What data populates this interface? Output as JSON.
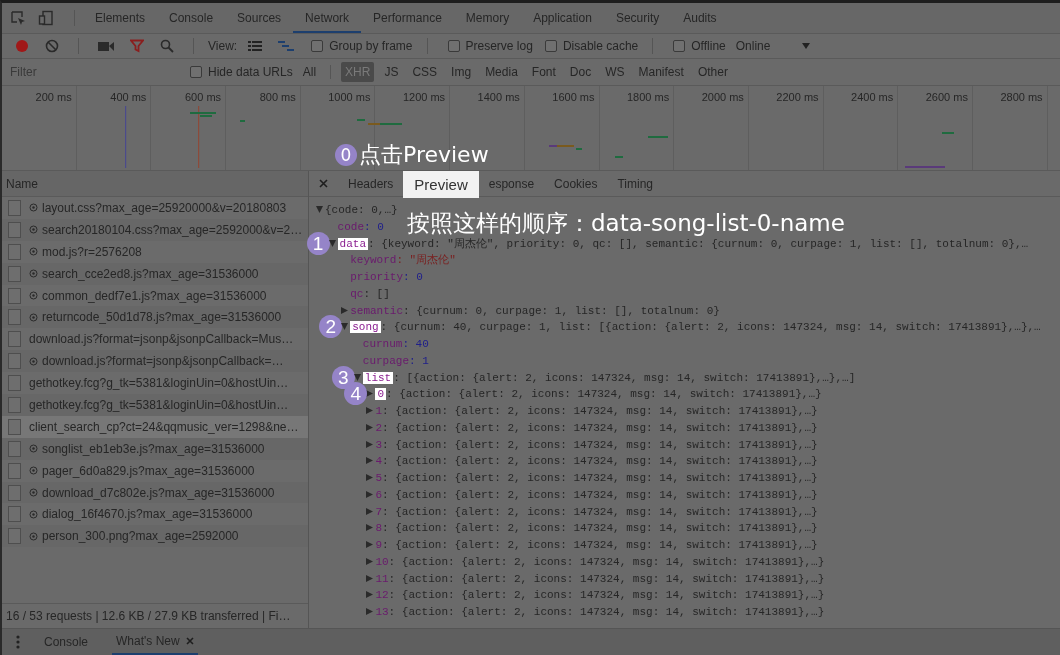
{
  "devtools_tabs": [
    {
      "label": "Elements",
      "selected": false
    },
    {
      "label": "Console",
      "selected": false
    },
    {
      "label": "Sources",
      "selected": false
    },
    {
      "label": "Network",
      "selected": true
    },
    {
      "label": "Performance",
      "selected": false
    },
    {
      "label": "Memory",
      "selected": false
    },
    {
      "label": "Application",
      "selected": false
    },
    {
      "label": "Security",
      "selected": false
    },
    {
      "label": "Audits",
      "selected": false
    }
  ],
  "toolbar": {
    "recording": true,
    "view_label": "View:",
    "options": [
      {
        "label": "Group by frame",
        "checked": false
      },
      {
        "label": "Preserve log",
        "checked": false
      },
      {
        "label": "Disable cache",
        "checked": false
      },
      {
        "label": "Offline",
        "checked": false
      }
    ],
    "throttling": "Online"
  },
  "filter": {
    "placeholder": "Filter",
    "hide_data_urls": {
      "label": "Hide data URLs",
      "checked": false
    },
    "types": [
      {
        "label": "All",
        "selected": false
      },
      {
        "label": "XHR",
        "selected": true
      },
      {
        "label": "JS",
        "selected": false
      },
      {
        "label": "CSS",
        "selected": false
      },
      {
        "label": "Img",
        "selected": false
      },
      {
        "label": "Media",
        "selected": false
      },
      {
        "label": "Font",
        "selected": false
      },
      {
        "label": "Doc",
        "selected": false
      },
      {
        "label": "WS",
        "selected": false
      },
      {
        "label": "Manifest",
        "selected": false
      },
      {
        "label": "Other",
        "selected": false
      }
    ]
  },
  "timeline": {
    "ticks": [
      "200 ms",
      "400 ms",
      "600 ms",
      "800 ms",
      "1000 ms",
      "1200 ms",
      "1400 ms",
      "1600 ms",
      "1800 ms",
      "2000 ms",
      "2200 ms",
      "2400 ms",
      "2600 ms",
      "2800 ms"
    ]
  },
  "annotation_step": {
    "badge": "0",
    "text": "点击Preview"
  },
  "instruction": "按照这样的顺序：data-song-list-0-name",
  "requests": {
    "header": "Name",
    "rows": [
      {
        "name": "layout.css?max_age=25920000&v=20180803",
        "cached": true,
        "selected": false
      },
      {
        "name": "search20180104.css?max_age=2592000&v=2…",
        "cached": true,
        "selected": false
      },
      {
        "name": "mod.js?r=2576208",
        "cached": true,
        "selected": false
      },
      {
        "name": "search_cce2ed8.js?max_age=31536000",
        "cached": true,
        "selected": false
      },
      {
        "name": "common_dedf7e1.js?max_age=31536000",
        "cached": true,
        "selected": false
      },
      {
        "name": "returncode_50d1d78.js?max_age=31536000",
        "cached": true,
        "selected": false
      },
      {
        "name": "download.js?format=jsonp&jsonpCallback=Mus…",
        "cached": false,
        "selected": false
      },
      {
        "name": "download.js?format=jsonp&jsonpCallback=…",
        "cached": true,
        "selected": false
      },
      {
        "name": "gethotkey.fcg?g_tk=5381&loginUin=0&hostUin…",
        "cached": false,
        "selected": false
      },
      {
        "name": "gethotkey.fcg?g_tk=5381&loginUin=0&hostUin…",
        "cached": false,
        "selected": false
      },
      {
        "name": "client_search_cp?ct=24&qqmusic_ver=1298&ne…",
        "cached": false,
        "selected": true
      },
      {
        "name": "songlist_eb1eb3e.js?max_age=31536000",
        "cached": true,
        "selected": false
      },
      {
        "name": "pager_6d0a829.js?max_age=31536000",
        "cached": true,
        "selected": false
      },
      {
        "name": "download_d7c802e.js?max_age=31536000",
        "cached": true,
        "selected": false
      },
      {
        "name": "dialog_16f4670.js?max_age=31536000",
        "cached": true,
        "selected": false
      },
      {
        "name": "person_300.png?max_age=2592000",
        "cached": true,
        "selected": false
      }
    ],
    "status": "16 / 53 requests | 12.6 KB / 27.9 KB transferred | Fi…"
  },
  "detail": {
    "tabs": [
      {
        "label": "Headers",
        "selected": false
      },
      {
        "label": "Preview",
        "selected": true
      },
      {
        "label": "esponse",
        "selected": false
      },
      {
        "label": "Cookies",
        "selected": false
      },
      {
        "label": "Timing",
        "selected": false
      }
    ],
    "tree": [
      {
        "value": "{code: 0,…}",
        "kind": "object",
        "expanded": true,
        "children": [
          {
            "key": "code",
            "value": ": 0",
            "kind": "number",
            "highlighted": false
          },
          {
            "key": "data",
            "badge": "1",
            "highlighted": true,
            "value": ": {keyword: \"周杰伦\", priority: 0, qc: [], semantic: {curnum: 0, curpage: 1, list: [], totalnum: 0},…",
            "kind": "object",
            "expanded": true,
            "children": [
              {
                "key": "keyword",
                "value": ": \"周杰伦\"",
                "kind": "string",
                "highlighted": false
              },
              {
                "key": "priority",
                "value": ": 0",
                "kind": "number",
                "highlighted": false
              },
              {
                "key": "qc",
                "value": ": []",
                "kind": "object",
                "highlighted": false
              },
              {
                "key": "semantic",
                "value": ": {curnum: 0, curpage: 1, list: [], totalnum: 0}",
                "kind": "object",
                "expanded": false,
                "highlighted": false
              },
              {
                "key": "song",
                "badge": "2",
                "highlighted": true,
                "value": ": {curnum: 40, curpage: 1, list: [{action: {alert: 2, icons: 147324, msg: 14, switch: 17413891},…},…",
                "kind": "object",
                "expanded": true,
                "children": [
                  {
                    "key": "curnum",
                    "value": ": 40",
                    "kind": "number",
                    "highlighted": false
                  },
                  {
                    "key": "curpage",
                    "value": ": 1",
                    "kind": "number",
                    "highlighted": false
                  },
                  {
                    "key": "list",
                    "badge": "3",
                    "highlighted": true,
                    "value": ": [{action: {alert: 2, icons: 147324, msg: 14, switch: 17413891},…},…]",
                    "kind": "object",
                    "expanded": true,
                    "children": [
                      {
                        "key": "0",
                        "badge": "4",
                        "highlighted": true,
                        "value": ": {action: {alert: 2, icons: 147324, msg: 14, switch: 17413891},…}",
                        "kind": "object",
                        "expanded": false
                      },
                      {
                        "key": "1",
                        "highlighted": false,
                        "value": ": {action: {alert: 2, icons: 147324, msg: 14, switch: 17413891},…}",
                        "kind": "object",
                        "expanded": false
                      },
                      {
                        "key": "2",
                        "highlighted": false,
                        "value": ": {action: {alert: 2, icons: 147324, msg: 14, switch: 17413891},…}",
                        "kind": "object",
                        "expanded": false
                      },
                      {
                        "key": "3",
                        "highlighted": false,
                        "value": ": {action: {alert: 2, icons: 147324, msg: 14, switch: 17413891},…}",
                        "kind": "object",
                        "expanded": false
                      },
                      {
                        "key": "4",
                        "highlighted": false,
                        "value": ": {action: {alert: 2, icons: 147324, msg: 14, switch: 17413891},…}",
                        "kind": "object",
                        "expanded": false
                      },
                      {
                        "key": "5",
                        "highlighted": false,
                        "value": ": {action: {alert: 2, icons: 147324, msg: 14, switch: 17413891},…}",
                        "kind": "object",
                        "expanded": false
                      },
                      {
                        "key": "6",
                        "highlighted": false,
                        "value": ": {action: {alert: 2, icons: 147324, msg: 14, switch: 17413891},…}",
                        "kind": "object",
                        "expanded": false
                      },
                      {
                        "key": "7",
                        "highlighted": false,
                        "value": ": {action: {alert: 2, icons: 147324, msg: 14, switch: 17413891},…}",
                        "kind": "object",
                        "expanded": false
                      },
                      {
                        "key": "8",
                        "highlighted": false,
                        "value": ": {action: {alert: 2, icons: 147324, msg: 14, switch: 17413891},…}",
                        "kind": "object",
                        "expanded": false
                      },
                      {
                        "key": "9",
                        "highlighted": false,
                        "value": ": {action: {alert: 2, icons: 147324, msg: 14, switch: 17413891},…}",
                        "kind": "object",
                        "expanded": false
                      },
                      {
                        "key": "10",
                        "highlighted": false,
                        "value": ": {action: {alert: 2, icons: 147324, msg: 14, switch: 17413891},…}",
                        "kind": "object",
                        "expanded": false
                      },
                      {
                        "key": "11",
                        "highlighted": false,
                        "value": ": {action: {alert: 2, icons: 147324, msg: 14, switch: 17413891},…}",
                        "kind": "object",
                        "expanded": false
                      },
                      {
                        "key": "12",
                        "highlighted": false,
                        "value": ": {action: {alert: 2, icons: 147324, msg: 14, switch: 17413891},…}",
                        "kind": "object",
                        "expanded": false
                      },
                      {
                        "key": "13",
                        "highlighted": false,
                        "value": ": {action: {alert: 2, icons: 147324, msg: 14, switch: 17413891},…}",
                        "kind": "object",
                        "expanded": false
                      }
                    ]
                  }
                ]
              }
            ]
          }
        ]
      }
    ]
  },
  "drawer": {
    "tabs": [
      {
        "label": "Console",
        "selected": false,
        "closable": false
      },
      {
        "label": "What's New",
        "selected": true,
        "closable": true
      }
    ]
  }
}
